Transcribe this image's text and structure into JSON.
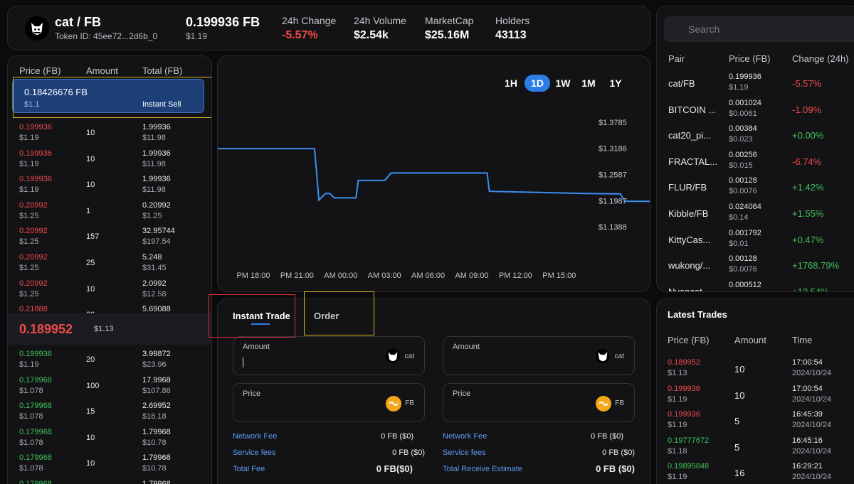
{
  "header": {
    "pair": "cat / FB",
    "token_id": "Token ID:  45ee72...2d6b_0",
    "price": "0.199936 FB",
    "price_usd": "$1.19",
    "stats": [
      {
        "label": "24h Change",
        "value": "-5.57%",
        "color": "#ef4a4a"
      },
      {
        "label": "24h Volume",
        "value": "$2.54k",
        "color": "#ffffff"
      },
      {
        "label": "MarketCap",
        "value": "$25.16M",
        "color": "#ffffff"
      },
      {
        "label": "Holders",
        "value": "43113",
        "color": "#ffffff"
      }
    ]
  },
  "search": {
    "placeholder": "Search"
  },
  "pairs": {
    "headers": [
      "Pair",
      "Price (FB)",
      "Change (24h)"
    ],
    "rows": [
      {
        "name": "cat/FB",
        "price": "0.199936",
        "usd": "$1.19",
        "change": "-5.57%",
        "dir": "down"
      },
      {
        "name": "BITCOIN ...",
        "price": "0.001024",
        "usd": "$0.0061",
        "change": "-1.09%",
        "dir": "down"
      },
      {
        "name": "cat20_pi...",
        "price": "0.00384",
        "usd": "$0.023",
        "change": "+0.00%",
        "dir": "up"
      },
      {
        "name": "FRACTAL...",
        "price": "0.00256",
        "usd": "$0.015",
        "change": "-6.74%",
        "dir": "down"
      },
      {
        "name": "FLUR/FB",
        "price": "0.00128",
        "usd": "$0.0076",
        "change": "+1.42%",
        "dir": "up"
      },
      {
        "name": "Kibble/FB",
        "price": "0.024064",
        "usd": "$0.14",
        "change": "+1.55%",
        "dir": "up"
      },
      {
        "name": "KittyCas...",
        "price": "0.001792",
        "usd": "$0.01",
        "change": "+0.47%",
        "dir": "up"
      },
      {
        "name": "wukong/...",
        "price": "0.00128",
        "usd": "$0.0076",
        "change": "+1768.79%",
        "dir": "up"
      },
      {
        "name": "Nyancat",
        "price": "0.000512",
        "usd": "",
        "change": "+13.54%",
        "dir": "up"
      }
    ]
  },
  "book": {
    "headers": [
      "Price (FB)",
      "Amount",
      "Total (FB)"
    ],
    "instant_sell": {
      "price": "0.18426676 FB",
      "usd": "$1.1",
      "label": "Instant Sell"
    },
    "asks": [
      {
        "price": "0.199936",
        "usd": "$1.19",
        "amount": "10",
        "total": "1.99936",
        "total_usd": "$11.98"
      },
      {
        "price": "0.199936",
        "usd": "$1.19",
        "amount": "10",
        "total": "1.99936",
        "total_usd": "$11.98"
      },
      {
        "price": "0.199936",
        "usd": "$1.19",
        "amount": "10",
        "total": "1.99936",
        "total_usd": "$11.98"
      },
      {
        "price": "0.20992",
        "usd": "$1.25",
        "amount": "1",
        "total": "0.20992",
        "total_usd": "$1.25"
      },
      {
        "price": "0.20992",
        "usd": "$1.25",
        "amount": "157",
        "total": "32.95744",
        "total_usd": "$197.54"
      },
      {
        "price": "0.20992",
        "usd": "$1.25",
        "amount": "25",
        "total": "5.248",
        "total_usd": "$31.45"
      },
      {
        "price": "0.20992",
        "usd": "$1.25",
        "amount": "10",
        "total": "2.0992",
        "total_usd": "$12.58"
      },
      {
        "price": "0.21888",
        "usd": "",
        "amount": "26",
        "total": "5.69088",
        "total_usd": ""
      }
    ],
    "mid": {
      "price": "0.189952",
      "usd": "$1.13"
    },
    "bids": [
      {
        "price": "0.199936",
        "usd": "$1.19",
        "amount": "20",
        "total": "3.99872",
        "total_usd": "$23.96"
      },
      {
        "price": "0.179968",
        "usd": "$1.078",
        "amount": "100",
        "total": "17.9968",
        "total_usd": "$107.86"
      },
      {
        "price": "0.179968",
        "usd": "$1.078",
        "amount": "15",
        "total": "2.69952",
        "total_usd": "$16.18"
      },
      {
        "price": "0.179968",
        "usd": "$1.078",
        "amount": "10",
        "total": "1.79968",
        "total_usd": "$10.78"
      },
      {
        "price": "0.179968",
        "usd": "$1.078",
        "amount": "10",
        "total": "1.79968",
        "total_usd": "$10.78"
      },
      {
        "price": "0.179968",
        "usd": "",
        "amount": "",
        "total": "1.79968",
        "total_usd": ""
      }
    ]
  },
  "chart": {
    "timeframes": [
      "1H",
      "1D",
      "1W",
      "1M",
      "1Y"
    ],
    "active_timeframe": "1D"
  },
  "chart_data": {
    "type": "line",
    "y_ticks": [
      "$1.3785",
      "$1.3186",
      "$1.2587",
      "$1.1987",
      "$1.1388"
    ],
    "y_tick_values": [
      1.3785,
      1.3186,
      1.2587,
      1.1987,
      1.1388
    ],
    "x_ticks": [
      "PM 18:00",
      "PM 21:00",
      "AM 00:00",
      "AM 03:00",
      "AM 06:00",
      "AM 09:00",
      "PM 12:00",
      "PM 15:00"
    ],
    "ylim": [
      1.1388,
      1.3785
    ],
    "color": "#3d8ef0",
    "points": [
      [
        -1.6,
        1.318
      ],
      [
        1.4,
        1.318
      ],
      [
        1.5,
        1.2
      ],
      [
        1.65,
        1.215
      ],
      [
        1.75,
        1.215
      ],
      [
        1.85,
        1.205
      ],
      [
        2.35,
        1.205
      ],
      [
        2.4,
        1.245
      ],
      [
        3.0,
        1.245
      ],
      [
        3.05,
        1.25
      ],
      [
        3.15,
        1.262
      ],
      [
        5.35,
        1.262
      ],
      [
        5.4,
        1.22
      ],
      [
        7.6,
        1.215
      ],
      [
        8.4,
        1.214
      ],
      [
        8.5,
        1.197
      ],
      [
        11.4,
        1.197
      ],
      [
        11.45,
        1.202
      ],
      [
        16.2,
        1.201
      ],
      [
        16.3,
        1.191
      ],
      [
        16.45,
        1.196
      ],
      [
        16.55,
        1.182
      ],
      [
        16.65,
        1.174
      ],
      [
        16.9,
        1.174
      ]
    ]
  },
  "trade": {
    "tabs": [
      "Instant Trade",
      "Order"
    ],
    "left": {
      "amount_label": "Amount",
      "amount_token": "cat",
      "price_label": "Price",
      "price_token": "FB",
      "fees": [
        {
          "label": "Network Fee",
          "value": "0 FB ($0)"
        },
        {
          "label": "Service fees",
          "value": "0 FB  ($0)"
        },
        {
          "label": "Total Fee",
          "value": "0 FB($0)"
        }
      ]
    },
    "right": {
      "amount_label": "Amount",
      "amount_token": "cat",
      "price_label": "Price",
      "price_token": "FB",
      "fees": [
        {
          "label": "Network Fee",
          "value": "0 FB ($0)"
        },
        {
          "label": "Service fees",
          "value": "0 FB  ($0)"
        },
        {
          "label": "Total Receive Estimate",
          "value": "0 FB  ($0)"
        }
      ]
    }
  },
  "latest": {
    "title": "Latest Trades",
    "headers": [
      "Price (FB)",
      "Amount",
      "Time"
    ],
    "rows": [
      {
        "price": "0.189952",
        "usd": "$1.13",
        "amount": "10",
        "time": "17:00:54",
        "date": "2024/10/24",
        "dir": "down"
      },
      {
        "price": "0.199936",
        "usd": "$1.19",
        "amount": "10",
        "time": "17:00:54",
        "date": "2024/10/24",
        "dir": "down"
      },
      {
        "price": "0.199936",
        "usd": "$1.19",
        "amount": "5",
        "time": "16:45:39",
        "date": "2024/10/24",
        "dir": "down"
      },
      {
        "price": "0.19777672",
        "usd": "$1.18",
        "amount": "5",
        "time": "16:45:16",
        "date": "2024/10/24",
        "dir": "up"
      },
      {
        "price": "0.19895848",
        "usd": "$1.19",
        "amount": "16",
        "time": "16:29:21",
        "date": "2024/10/24",
        "dir": "up"
      }
    ]
  }
}
